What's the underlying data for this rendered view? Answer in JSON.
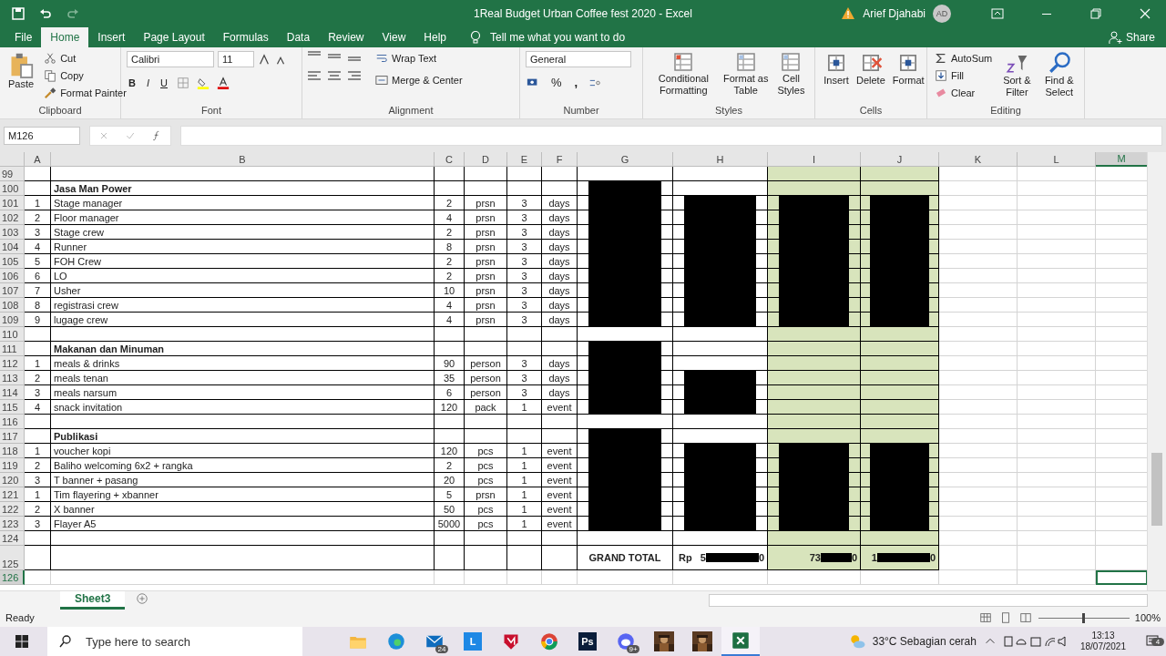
{
  "window": {
    "title": "1Real Budget Urban Coffee fest 2020  -  Excel",
    "user": "Arief Djahabi",
    "avatar": "AD"
  },
  "menu_tabs": [
    {
      "label": "File",
      "selected": false
    },
    {
      "label": "Home",
      "selected": true
    },
    {
      "label": "Insert",
      "selected": false
    },
    {
      "label": "Page Layout",
      "selected": false
    },
    {
      "label": "Formulas",
      "selected": false
    },
    {
      "label": "Data",
      "selected": false
    },
    {
      "label": "Review",
      "selected": false
    },
    {
      "label": "View",
      "selected": false
    },
    {
      "label": "Help",
      "selected": false
    }
  ],
  "tell_me": "Tell me what you want to do",
  "share": "Share",
  "ribbon": {
    "clipboard": {
      "label": "Clipboard",
      "paste": "Paste",
      "cut": "Cut",
      "copy": "Copy",
      "format_painter": "Format Painter"
    },
    "font": {
      "label": "Font",
      "family": "Calibri",
      "size": "11",
      "bold": "B",
      "italic": "I",
      "underline": "U"
    },
    "alignment": {
      "label": "Alignment",
      "wrap": "Wrap Text",
      "merge": "Merge & Center"
    },
    "number": {
      "label": "Number",
      "format": "General",
      "percent": "%",
      "comma": ","
    },
    "styles": {
      "label": "Styles",
      "buttons": [
        "Conditional Formatting",
        "Format as Table",
        "Cell Styles"
      ]
    },
    "cells": {
      "label": "Cells",
      "buttons": [
        "Insert",
        "Delete",
        "Format"
      ]
    },
    "editing": {
      "label": "Editing",
      "autosum": "AutoSum",
      "fill": "Fill",
      "clear": "Clear",
      "sort": "Sort & Filter",
      "find": "Find & Select"
    }
  },
  "name_box": "M126",
  "columns": [
    {
      "label": "A",
      "selected": false
    },
    {
      "label": "B",
      "selected": false
    },
    {
      "label": "C",
      "selected": false
    },
    {
      "label": "D",
      "selected": false
    },
    {
      "label": "E",
      "selected": false
    },
    {
      "label": "F",
      "selected": false
    },
    {
      "label": "G",
      "selected": false
    },
    {
      "label": "H",
      "selected": false
    },
    {
      "label": "I",
      "selected": false
    },
    {
      "label": "J",
      "selected": false
    },
    {
      "label": "K",
      "selected": false
    },
    {
      "label": "L",
      "selected": false
    },
    {
      "label": "M",
      "selected": true
    }
  ],
  "rows": [
    {
      "header": "99",
      "selected": false,
      "redacted": {
        "g": false,
        "h": false,
        "i": false,
        "j": false
      }
    },
    {
      "header": "100",
      "selected": false,
      "b": "Jasa Man Power",
      "bold": true,
      "redacted": {
        "g": true,
        "h": false,
        "i": false,
        "j": false
      }
    },
    {
      "header": "101",
      "selected": false,
      "a": "1",
      "b": "Stage manager",
      "c": "2",
      "d": "prsn",
      "e": "3",
      "f": "days",
      "bold": false,
      "redacted": {
        "g": true,
        "h": true,
        "i": true,
        "j": true
      }
    },
    {
      "header": "102",
      "selected": false,
      "a": "2",
      "b": "Floor  manager",
      "c": "4",
      "d": "prsn",
      "e": "3",
      "f": "days",
      "bold": false,
      "redacted": {
        "g": true,
        "h": true,
        "i": true,
        "j": true
      }
    },
    {
      "header": "103",
      "selected": false,
      "a": "3",
      "b": "Stage crew",
      "c": "2",
      "d": "prsn",
      "e": "3",
      "f": "days",
      "bold": false,
      "redacted": {
        "g": true,
        "h": true,
        "i": true,
        "j": true
      }
    },
    {
      "header": "104",
      "selected": false,
      "a": "4",
      "b": "Runner",
      "c": "8",
      "d": "prsn",
      "e": "3",
      "f": "days",
      "bold": false,
      "redacted": {
        "g": true,
        "h": true,
        "i": true,
        "j": true
      }
    },
    {
      "header": "105",
      "selected": false,
      "a": "5",
      "b": "FOH Crew",
      "c": "2",
      "d": "prsn",
      "e": "3",
      "f": "days",
      "bold": false,
      "redacted": {
        "g": true,
        "h": true,
        "i": true,
        "j": true
      }
    },
    {
      "header": "106",
      "selected": false,
      "a": "6",
      "b": "LO",
      "c": "2",
      "d": "prsn",
      "e": "3",
      "f": "days",
      "bold": false,
      "redacted": {
        "g": true,
        "h": true,
        "i": true,
        "j": true
      }
    },
    {
      "header": "107",
      "selected": false,
      "a": "7",
      "b": "Usher",
      "c": "10",
      "d": "prsn",
      "e": "3",
      "f": "days",
      "bold": false,
      "redacted": {
        "g": true,
        "h": true,
        "i": true,
        "j": true
      }
    },
    {
      "header": "108",
      "selected": false,
      "a": "8",
      "b": "registrasi crew",
      "c": "4",
      "d": "prsn",
      "e": "3",
      "f": "days",
      "bold": false,
      "redacted": {
        "g": true,
        "h": true,
        "i": true,
        "j": true
      }
    },
    {
      "header": "109",
      "selected": false,
      "a": "9",
      "b": "lugage crew",
      "c": "4",
      "d": "prsn",
      "e": "3",
      "f": "days",
      "bold": false,
      "redacted": {
        "g": true,
        "h": true,
        "i": true,
        "j": true
      }
    },
    {
      "header": "110",
      "selected": false,
      "redacted": {
        "g": false,
        "h": false,
        "i": false,
        "j": false
      }
    },
    {
      "header": "111",
      "selected": false,
      "b": "Makanan dan Minuman",
      "bold": true,
      "redacted": {
        "g": true,
        "h": false,
        "i": false,
        "j": false
      }
    },
    {
      "header": "112",
      "selected": false,
      "a": "1",
      "b": "meals & drinks",
      "c": "90",
      "d": "person",
      "e": "3",
      "f": "days",
      "bold": false,
      "redacted": {
        "g": true,
        "h": false,
        "i": false,
        "j": false
      }
    },
    {
      "header": "113",
      "selected": false,
      "a": "2",
      "b": "meals tenan",
      "c": "35",
      "d": "person",
      "e": "3",
      "f": "days",
      "bold": false,
      "redacted": {
        "g": true,
        "h": true,
        "i": false,
        "j": false
      }
    },
    {
      "header": "114",
      "selected": false,
      "a": "3",
      "b": "meals narsum",
      "c": "6",
      "d": "person",
      "e": "3",
      "f": "days",
      "bold": false,
      "redacted": {
        "g": true,
        "h": true,
        "i": false,
        "j": false
      }
    },
    {
      "header": "115",
      "selected": false,
      "a": "4",
      "b": "snack invitation",
      "c": "120",
      "d": "pack",
      "e": "1",
      "f": "event",
      "bold": false,
      "redacted": {
        "g": true,
        "h": true,
        "i": false,
        "j": false
      }
    },
    {
      "header": "116",
      "selected": false,
      "redacted": {
        "g": false,
        "h": false,
        "i": false,
        "j": false
      }
    },
    {
      "header": "117",
      "selected": false,
      "b": "Publikasi",
      "bold": true,
      "redacted": {
        "g": true,
        "h": false,
        "i": false,
        "j": false
      }
    },
    {
      "header": "118",
      "selected": false,
      "a": "1",
      "b": "voucher kopi",
      "c": "120",
      "d": "pcs",
      "e": "1",
      "f": "event",
      "bold": false,
      "redacted": {
        "g": true,
        "h": true,
        "i": true,
        "j": true
      }
    },
    {
      "header": "119",
      "selected": false,
      "a": "2",
      "b": "Baliho welcoming 6x2 + rangka",
      "c": "2",
      "d": "pcs",
      "e": "1",
      "f": "event",
      "bold": false,
      "redacted": {
        "g": true,
        "h": true,
        "i": true,
        "j": true
      }
    },
    {
      "header": "120",
      "selected": false,
      "a": "3",
      "b": "T banner + pasang",
      "c": "20",
      "d": "pcs",
      "e": "1",
      "f": "event",
      "bold": false,
      "redacted": {
        "g": true,
        "h": true,
        "i": true,
        "j": true
      }
    },
    {
      "header": "121",
      "selected": false,
      "a": "1",
      "b": "Tim flayering + xbanner",
      "c": "5",
      "d": "prsn",
      "e": "1",
      "f": "event",
      "bold": false,
      "redacted": {
        "g": true,
        "h": true,
        "i": true,
        "j": true
      }
    },
    {
      "header": "122",
      "selected": false,
      "a": "2",
      "b": "X banner",
      "c": "50",
      "d": "pcs",
      "e": "1",
      "f": "event",
      "bold": false,
      "redacted": {
        "g": true,
        "h": true,
        "i": true,
        "j": true
      }
    },
    {
      "header": "123",
      "selected": false,
      "a": "3",
      "b": "Flayer A5",
      "c": "5000",
      "d": "pcs",
      "e": "1",
      "f": "event",
      "bold": false,
      "redacted": {
        "g": true,
        "h": true,
        "i": true,
        "j": true
      }
    },
    {
      "header": "124",
      "selected": false,
      "redacted": {
        "g": false,
        "h": false,
        "i": false,
        "j": false
      }
    }
  ],
  "grand_total": {
    "header": "125",
    "selected": false,
    "label": "GRAND TOTAL",
    "currency": "Rp",
    "amounts": [
      {
        "head": "5",
        "tail": "0"
      },
      {
        "head": "73",
        "tail": "0"
      },
      {
        "head": "1",
        "tail": "0"
      }
    ]
  },
  "selected_row": {
    "header": "126",
    "selected": true
  },
  "sheet_tabs": [
    {
      "label": "Sheet3",
      "selected": true
    }
  ],
  "status_bar": {
    "status": "Ready",
    "zoom": "100%",
    "zoom_slider": {
      "level": 0.5
    }
  },
  "taskbar": {
    "search_placeholder": "Type here to search",
    "apps": [
      {
        "kind": "folder"
      },
      {
        "kind": "edge"
      },
      {
        "kind": "mail",
        "badge": "24"
      },
      {
        "kind": "tile",
        "glyph": "L",
        "color": "#1e88e5"
      },
      {
        "kind": "shield"
      },
      {
        "kind": "chrome"
      },
      {
        "kind": "tile",
        "glyph": "Ps",
        "color": "#0a1d3a"
      },
      {
        "kind": "discord",
        "badge": "9+"
      },
      {
        "kind": "picture"
      },
      {
        "kind": "picture"
      },
      {
        "kind": "excel"
      }
    ],
    "weather": "33°C  Sebagian cerah",
    "time": "13:13",
    "date": "18/07/2021",
    "notifications": "4"
  }
}
